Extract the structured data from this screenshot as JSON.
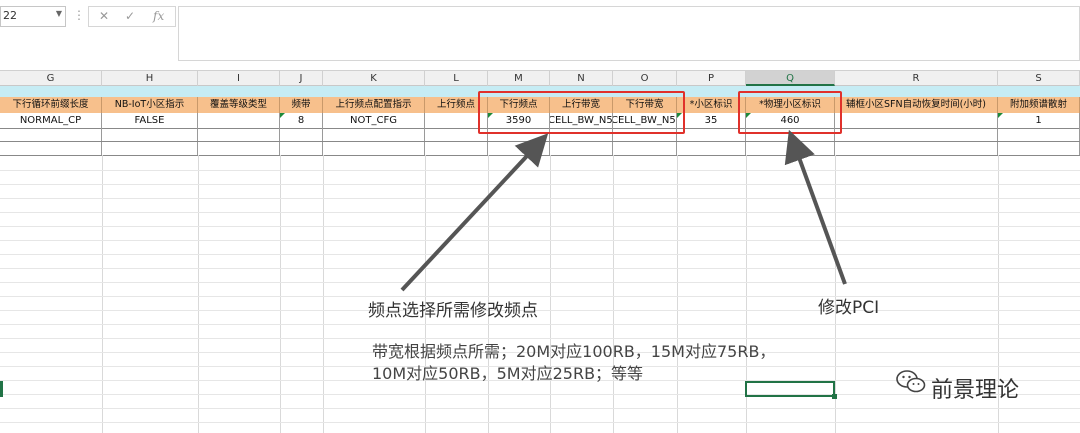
{
  "formula_bar": {
    "name_box": "22",
    "cancel_icon": "✕",
    "confirm_icon": "✓",
    "fx_label": "fx",
    "formula_value": ""
  },
  "columns": [
    "G",
    "H",
    "I",
    "J",
    "K",
    "L",
    "M",
    "N",
    "O",
    "P",
    "Q",
    "R",
    "S"
  ],
  "selected_column": "Q",
  "header_row": [
    "下行循环前缀长度",
    "NB-IoT小区指示",
    "覆盖等级类型",
    "频带",
    "上行频点配置指示",
    "上行频点",
    "下行频点",
    "上行带宽",
    "下行带宽",
    "*小区标识",
    "*物理小区标识",
    "辅框小区SFN自动恢复时间(小时)",
    "附加频谱散射"
  ],
  "data_row": [
    "NORMAL_CP",
    "FALSE",
    "",
    "8",
    "NOT_CFG",
    "",
    "3590",
    "CELL_BW_N50",
    "CELL_BW_N50",
    "35",
    "460",
    "",
    "1"
  ],
  "annotations": {
    "freq_label": "频点选择所需修改频点",
    "pci_label": "修改PCI",
    "bandwidth_note_line1": "带宽根据频点所需；20M对应100RB，15M对应75RB，",
    "bandwidth_note_line2": "10M对应50RB，5M对应25RB；等等"
  },
  "watermark": {
    "text": "前景理论",
    "icon": "wechat-icon"
  },
  "colors": {
    "header_fill": "#f7c08c",
    "band_fill": "#c6ecf4",
    "highlight": "#e0312b",
    "excel_green": "#217346"
  }
}
